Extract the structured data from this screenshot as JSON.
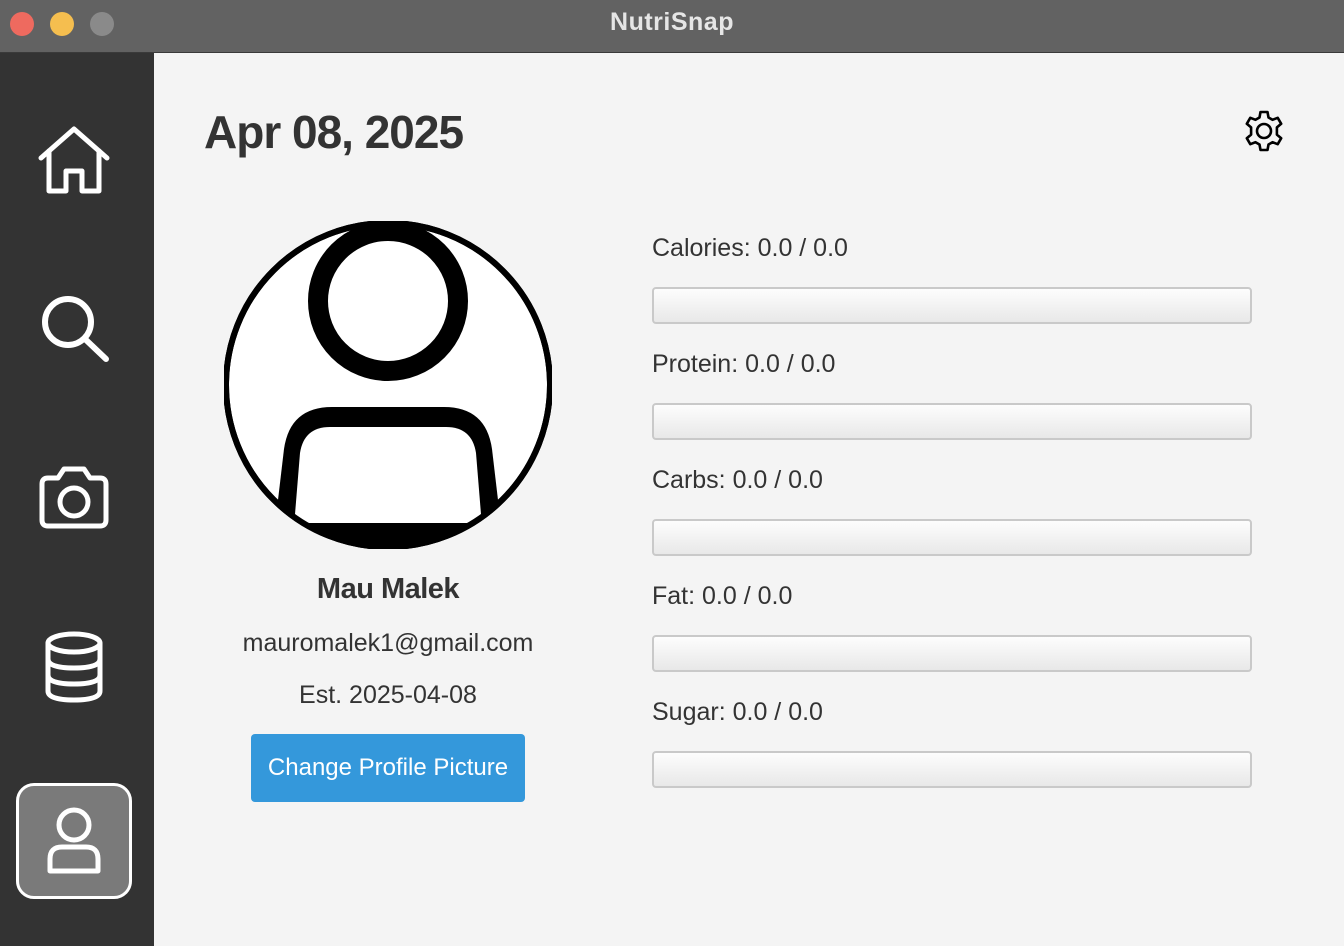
{
  "window": {
    "title": "NutriSnap"
  },
  "sidebar": {
    "items": [
      {
        "icon": "home-icon",
        "active": false
      },
      {
        "icon": "search-icon",
        "active": false
      },
      {
        "icon": "camera-icon",
        "active": false
      },
      {
        "icon": "database-icon",
        "active": false
      },
      {
        "icon": "user-icon",
        "active": true
      }
    ]
  },
  "header": {
    "date": "Apr 08, 2025",
    "settings_icon": "gear-icon"
  },
  "profile": {
    "name": "Mau Malek",
    "email": "mauromalek1@gmail.com",
    "established": "Est. 2025-04-08",
    "change_picture_label": "Change Profile Picture"
  },
  "nutrition": [
    {
      "label": "Calories: 0.0 / 0.0",
      "progress": 0
    },
    {
      "label": "Protein: 0.0 / 0.0",
      "progress": 0
    },
    {
      "label": "Carbs: 0.0 / 0.0",
      "progress": 0
    },
    {
      "label": "Fat: 0.0 / 0.0",
      "progress": 0
    },
    {
      "label": "Sugar: 0.0 / 0.0",
      "progress": 0
    }
  ],
  "colors": {
    "sidebar_bg": "#333333",
    "accent": "#3498db",
    "titlebar": "#626262"
  }
}
